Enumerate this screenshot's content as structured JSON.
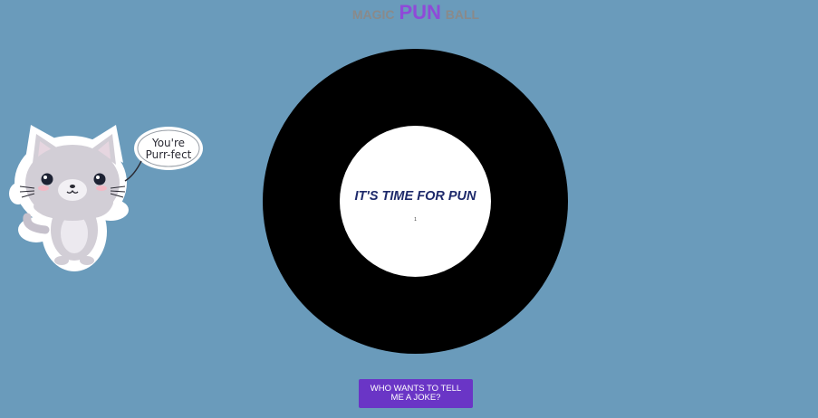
{
  "header": {
    "title_part1": "MAGIC",
    "title_part2": "PUN",
    "title_part3": "BALL"
  },
  "sticker": {
    "speech_line1": "You're",
    "speech_line2": "Purr-fect",
    "icon": "cat-sticker"
  },
  "ball": {
    "answer_text": "IT'S TIME FOR PUN",
    "counter_text": "1"
  },
  "actions": {
    "ask_button_label": "WHO WANTS TO TELL ME A JOKE?"
  },
  "colors": {
    "background": "#6a9bbb",
    "ball": "#000000",
    "window": "#ffffff",
    "answer_text": "#1e2a6b",
    "button": "#6a35c6",
    "title_accent": "#8f4ad8",
    "title_gray": "#8a8a8a"
  }
}
